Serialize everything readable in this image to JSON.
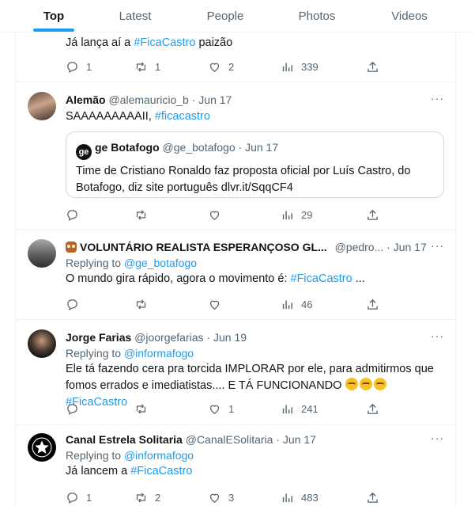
{
  "tabs": [
    {
      "label": "Top",
      "active": true
    },
    {
      "label": "Latest",
      "active": false
    },
    {
      "label": "People",
      "active": false
    },
    {
      "label": "Photos",
      "active": false
    },
    {
      "label": "Videos",
      "active": false
    }
  ],
  "tweets": [
    {
      "text_prefix": "Já lança aí a ",
      "hashtag": "#FicaCastro",
      "text_suffix": " paizão",
      "stats": {
        "replies": "1",
        "retweets": "1",
        "likes": "2",
        "views": "339"
      }
    },
    {
      "name": "Alemão",
      "handle": "@alemauricio_b",
      "dot": "·",
      "time": "Jun 17",
      "text_prefix": "SAAAAAAAAAII, ",
      "hashtag": "#ficacastro",
      "quote": {
        "logo": "ge",
        "name": "ge Botafogo",
        "handle": "@ge_botafogo",
        "dot": "·",
        "time": "Jun 17",
        "text": "Time de Cristiano Ronaldo faz proposta oficial por Luís Castro, do Botafogo, diz site português dlvr.it/SqqCF4"
      },
      "stats": {
        "replies": "",
        "retweets": "",
        "likes": "",
        "views": "29"
      }
    },
    {
      "name": "VOLUNTÁRIO REALISTA ESPERANÇOSO GL...",
      "handle": "@pedro...",
      "dot": "·",
      "time": "Jun 17",
      "replying_label": "Replying to ",
      "replying_to": "@ge_botafogo",
      "text_prefix": "O mundo gira rápido, agora o movimento é: ",
      "hashtag": "#FicaCastro",
      "text_suffix": " ...",
      "stats": {
        "replies": "",
        "retweets": "",
        "likes": "",
        "views": "46"
      }
    },
    {
      "name": "Jorge Farias",
      "handle": "@joorgefarias",
      "dot": "·",
      "time": "Jun 19",
      "replying_label": "Replying to ",
      "replying_to": "@informafogo",
      "text_prefix": "Ele tá fazendo cera pra torcida IMPLORAR por ele, para admitirmos que fomos errados e imediatistas.... E TÁ FUNCIONANDO ",
      "hashtag": "#FicaCastro",
      "stats": {
        "replies": "",
        "retweets": "",
        "likes": "1",
        "views": "241"
      }
    },
    {
      "name": "Canal Estrela Solitaria",
      "handle": "@CanalESolitaria",
      "dot": "·",
      "time": "Jun 17",
      "replying_label": "Replying to ",
      "replying_to": "@informafogo",
      "text_prefix": "Já lancem a ",
      "hashtag": "#FicaCastro",
      "stats": {
        "replies": "1",
        "retweets": "2",
        "likes": "3",
        "views": "483"
      }
    }
  ],
  "more_glyph": "···",
  "colors": {
    "accent": "#1d9bf0",
    "text": "#0f1419",
    "muted": "#536471",
    "border": "#eff3f4"
  }
}
